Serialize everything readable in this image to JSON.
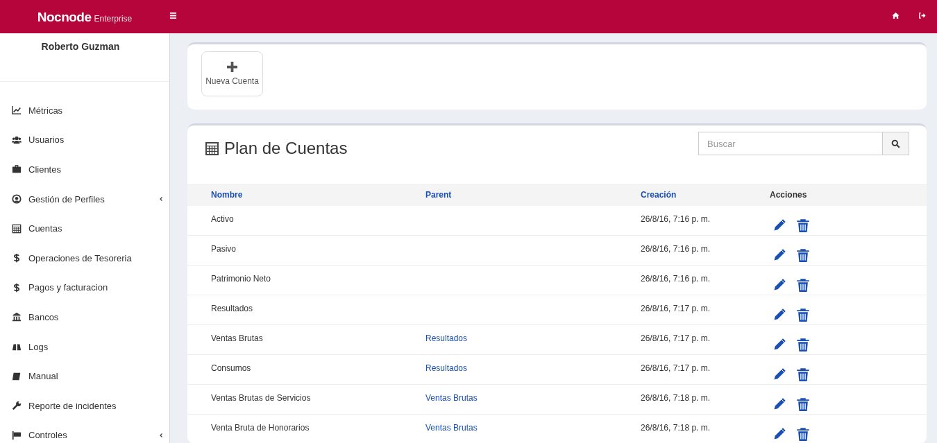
{
  "header": {
    "brand": "Nocnode",
    "edition": "Enterprise"
  },
  "sidebar": {
    "user": "Roberto Guzman",
    "items": [
      {
        "label": "Métricas",
        "submenu": false
      },
      {
        "label": "Usuarios",
        "submenu": false
      },
      {
        "label": "Clientes",
        "submenu": false
      },
      {
        "label": "Gestión de Perfiles",
        "submenu": true
      },
      {
        "label": "Cuentas",
        "submenu": false
      },
      {
        "label": "Operaciones de Tesoreria",
        "submenu": false
      },
      {
        "label": "Pagos y facturacion",
        "submenu": false
      },
      {
        "label": "Bancos",
        "submenu": false
      },
      {
        "label": "Logs",
        "submenu": false
      },
      {
        "label": "Manual",
        "submenu": false
      },
      {
        "label": "Reporte de incidentes",
        "submenu": false
      },
      {
        "label": "Controles",
        "submenu": true
      }
    ]
  },
  "toolbar": {
    "new_button": "Nueva Cuenta"
  },
  "panel": {
    "title": "Plan de Cuentas",
    "search": {
      "placeholder": "Buscar"
    }
  },
  "table": {
    "columns": [
      {
        "label": "Nombre",
        "sortable": true
      },
      {
        "label": "Parent",
        "sortable": true
      },
      {
        "label": "Creación",
        "sortable": true
      },
      {
        "label": "Acciones",
        "sortable": false
      }
    ],
    "rows": [
      {
        "name": "Activo",
        "created": "26/8/16, 7:16 p. m."
      },
      {
        "name": "Pasivo",
        "created": "26/8/16, 7:16 p. m."
      },
      {
        "name": "Patrimonio Neto",
        "created": "26/8/16, 7:16 p. m."
      },
      {
        "name": "Resultados",
        "created": "26/8/16, 7:17 p. m."
      },
      {
        "name": "Ventas Brutas",
        "parent": "Resultados",
        "created": "26/8/16, 7:17 p. m."
      },
      {
        "name": "Consumos",
        "parent": "Resultados",
        "created": "26/8/16, 7:17 p. m."
      },
      {
        "name": "Ventas Brutas de Servicios",
        "parent": "Ventas Brutas",
        "created": "26/8/16, 7:18 p. m."
      },
      {
        "name": "Venta Bruta de Honorarios",
        "parent": "Ventas Brutas",
        "created": "26/8/16, 7:18 p. m."
      }
    ]
  }
}
